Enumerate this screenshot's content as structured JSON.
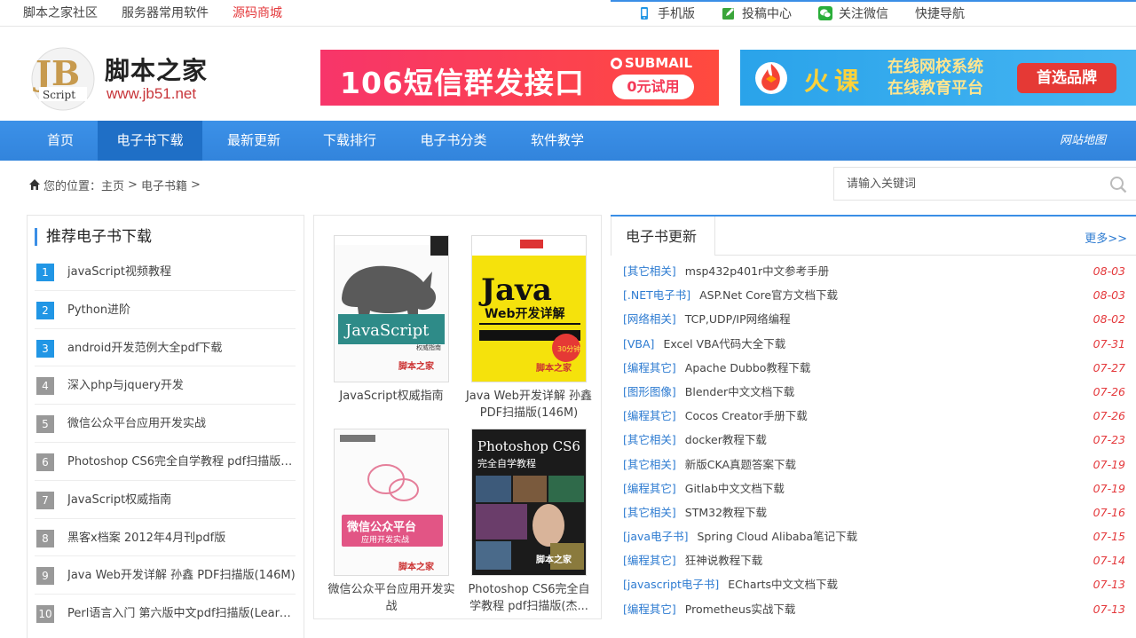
{
  "topbar": {
    "links": [
      "脚本之家社区",
      "服务器常用软件",
      "源码商城"
    ],
    "right": [
      "手机版",
      "投稿中心",
      "关注微信",
      "快捷导航"
    ]
  },
  "logo": {
    "name": "脚本之家",
    "url": "www.jb51.net",
    "mark": "JB",
    "mark_sub": "Script"
  },
  "ad1": {
    "text": "106短信群发接口",
    "brand": "SUBMAIL",
    "button": "0元试用"
  },
  "ad2": {
    "brand": "火课",
    "line1": "在线网校系统",
    "line2": "在线教育平台",
    "button": "首选品牌"
  },
  "nav": {
    "items": [
      "首页",
      "电子书下载",
      "最新更新",
      "下载排行",
      "电子书分类",
      "软件教学"
    ],
    "sitemap": "网站地图"
  },
  "breadcrumb": {
    "label": "您的位置：",
    "home": "主页",
    "sep": ">",
    "section": "电子书籍",
    "end": ">"
  },
  "search": {
    "placeholder": "请输入关键词"
  },
  "recommend": {
    "title": "推荐电子书下载",
    "items": [
      "javaScript视频教程",
      "Python进阶",
      "android开发范例大全pdf下载",
      "深入php与jquery开发",
      "微信公众平台应用开发实战",
      "Photoshop CS6完全自学教程 pdf扫描版(杰诚...",
      "JavaScript权威指南",
      "黑客x档案 2012年4月刊pdf版",
      "Java Web开发详解 孙鑫 PDF扫描版(146M)",
      "Perl语言入门 第六版中文pdf扫描版(Learning..."
    ]
  },
  "books": [
    {
      "title": "JavaScript权威指南",
      "cover": "JavaScript",
      "cover_sub": "权威指南"
    },
    {
      "title": "Java Web开发详解 孙鑫 PDF扫描版(146M)",
      "cover": "Java",
      "cover_sub": "Web开发详解"
    },
    {
      "title": "微信公众平台应用开发实战",
      "cover": "微信公众平台",
      "cover_sub": "应用开发实战"
    },
    {
      "title": "Photoshop CS6完全自学教程 pdf扫描版(杰...",
      "cover": "Photoshop CS6",
      "cover_sub": "完全自学教程"
    }
  ],
  "updates": {
    "title": "电子书更新",
    "more": "更多>>",
    "items": [
      {
        "cat": "[其它相关]",
        "title": "msp432p401r中文参考手册",
        "date": "08-03"
      },
      {
        "cat": "[.NET电子书]",
        "title": "ASP.Net Core官方文档下载",
        "date": "08-03"
      },
      {
        "cat": "[网络相关]",
        "title": "TCP,UDP/IP网络编程",
        "date": "08-02"
      },
      {
        "cat": "[VBA]",
        "title": "Excel VBA代码大全下载",
        "date": "07-31"
      },
      {
        "cat": "[编程其它]",
        "title": "Apache Dubbo教程下载",
        "date": "07-27"
      },
      {
        "cat": "[图形图像]",
        "title": "Blender中文文档下载",
        "date": "07-26"
      },
      {
        "cat": "[编程其它]",
        "title": "Cocos Creator手册下载",
        "date": "07-26"
      },
      {
        "cat": "[其它相关]",
        "title": "docker教程下载",
        "date": "07-23"
      },
      {
        "cat": "[其它相关]",
        "title": "新版CKA真题答案下载",
        "date": "07-19"
      },
      {
        "cat": "[编程其它]",
        "title": "Gitlab中文文档下载",
        "date": "07-19"
      },
      {
        "cat": "[其它相关]",
        "title": "STM32教程下载",
        "date": "07-16"
      },
      {
        "cat": "[java电子书]",
        "title": "Spring Cloud Alibaba笔记下载",
        "date": "07-15"
      },
      {
        "cat": "[编程其它]",
        "title": "狂神说教程下载",
        "date": "07-14"
      },
      {
        "cat": "[javascript电子书]",
        "title": "ECharts中文文档下载",
        "date": "07-13"
      },
      {
        "cat": "[编程其它]",
        "title": "Prometheus实战下载",
        "date": "07-13"
      }
    ]
  },
  "colors": {
    "accent": "#3a8ee6",
    "nav_active": "#1f6fc6",
    "hot": "#e4393c",
    "link": "#2d7bd1"
  }
}
